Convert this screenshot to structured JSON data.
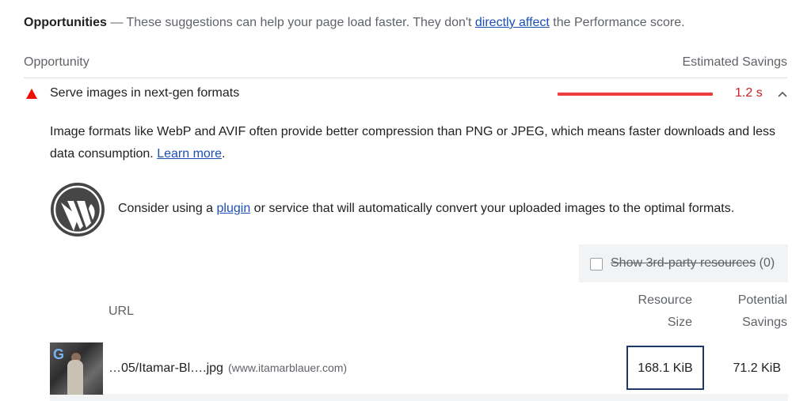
{
  "header": {
    "title": "Opportunities",
    "dash": " — ",
    "text_before_link": "These suggestions can help your page load faster. They don't ",
    "link": "directly affect",
    "text_after_link": " the Performance score."
  },
  "columns": {
    "opportunity": "Opportunity",
    "estimated_savings": "Estimated Savings"
  },
  "audit": {
    "title": "Serve images in next-gen formats",
    "savings": "1.2 s",
    "savings_fraction": 1.0,
    "status_color": "#eb0f00",
    "icon": "warning-triangle-icon",
    "expand_icon": "chevron-up-icon"
  },
  "description": {
    "text": "Image formats like WebP and AVIF often provide better compression than PNG or JPEG, which means faster downloads and less data consumption. ",
    "link": "Learn more",
    "end": "."
  },
  "stack_pack": {
    "icon": "wordpress-logo-icon",
    "text_before_link": "Consider using a ",
    "link": "plugin",
    "text_after_link": " or service that will automatically convert your uploaded images to the optimal formats."
  },
  "third_party": {
    "checked": false,
    "label": "Show 3rd-party resources",
    "count": " (0)"
  },
  "table": {
    "headers": {
      "url": "URL",
      "resource_size_1": "Resource",
      "resource_size_2": "Size",
      "potential_savings_1": "Potential",
      "potential_savings_2": "Savings"
    },
    "rows": [
      {
        "thumbnail": "image-thumbnail",
        "url": "…05/Itamar-Bl….jpg",
        "origin": "(www.itamarblauer.com)",
        "resource_size": "168.1 KiB",
        "potential_savings": "71.2 KiB"
      }
    ]
  }
}
